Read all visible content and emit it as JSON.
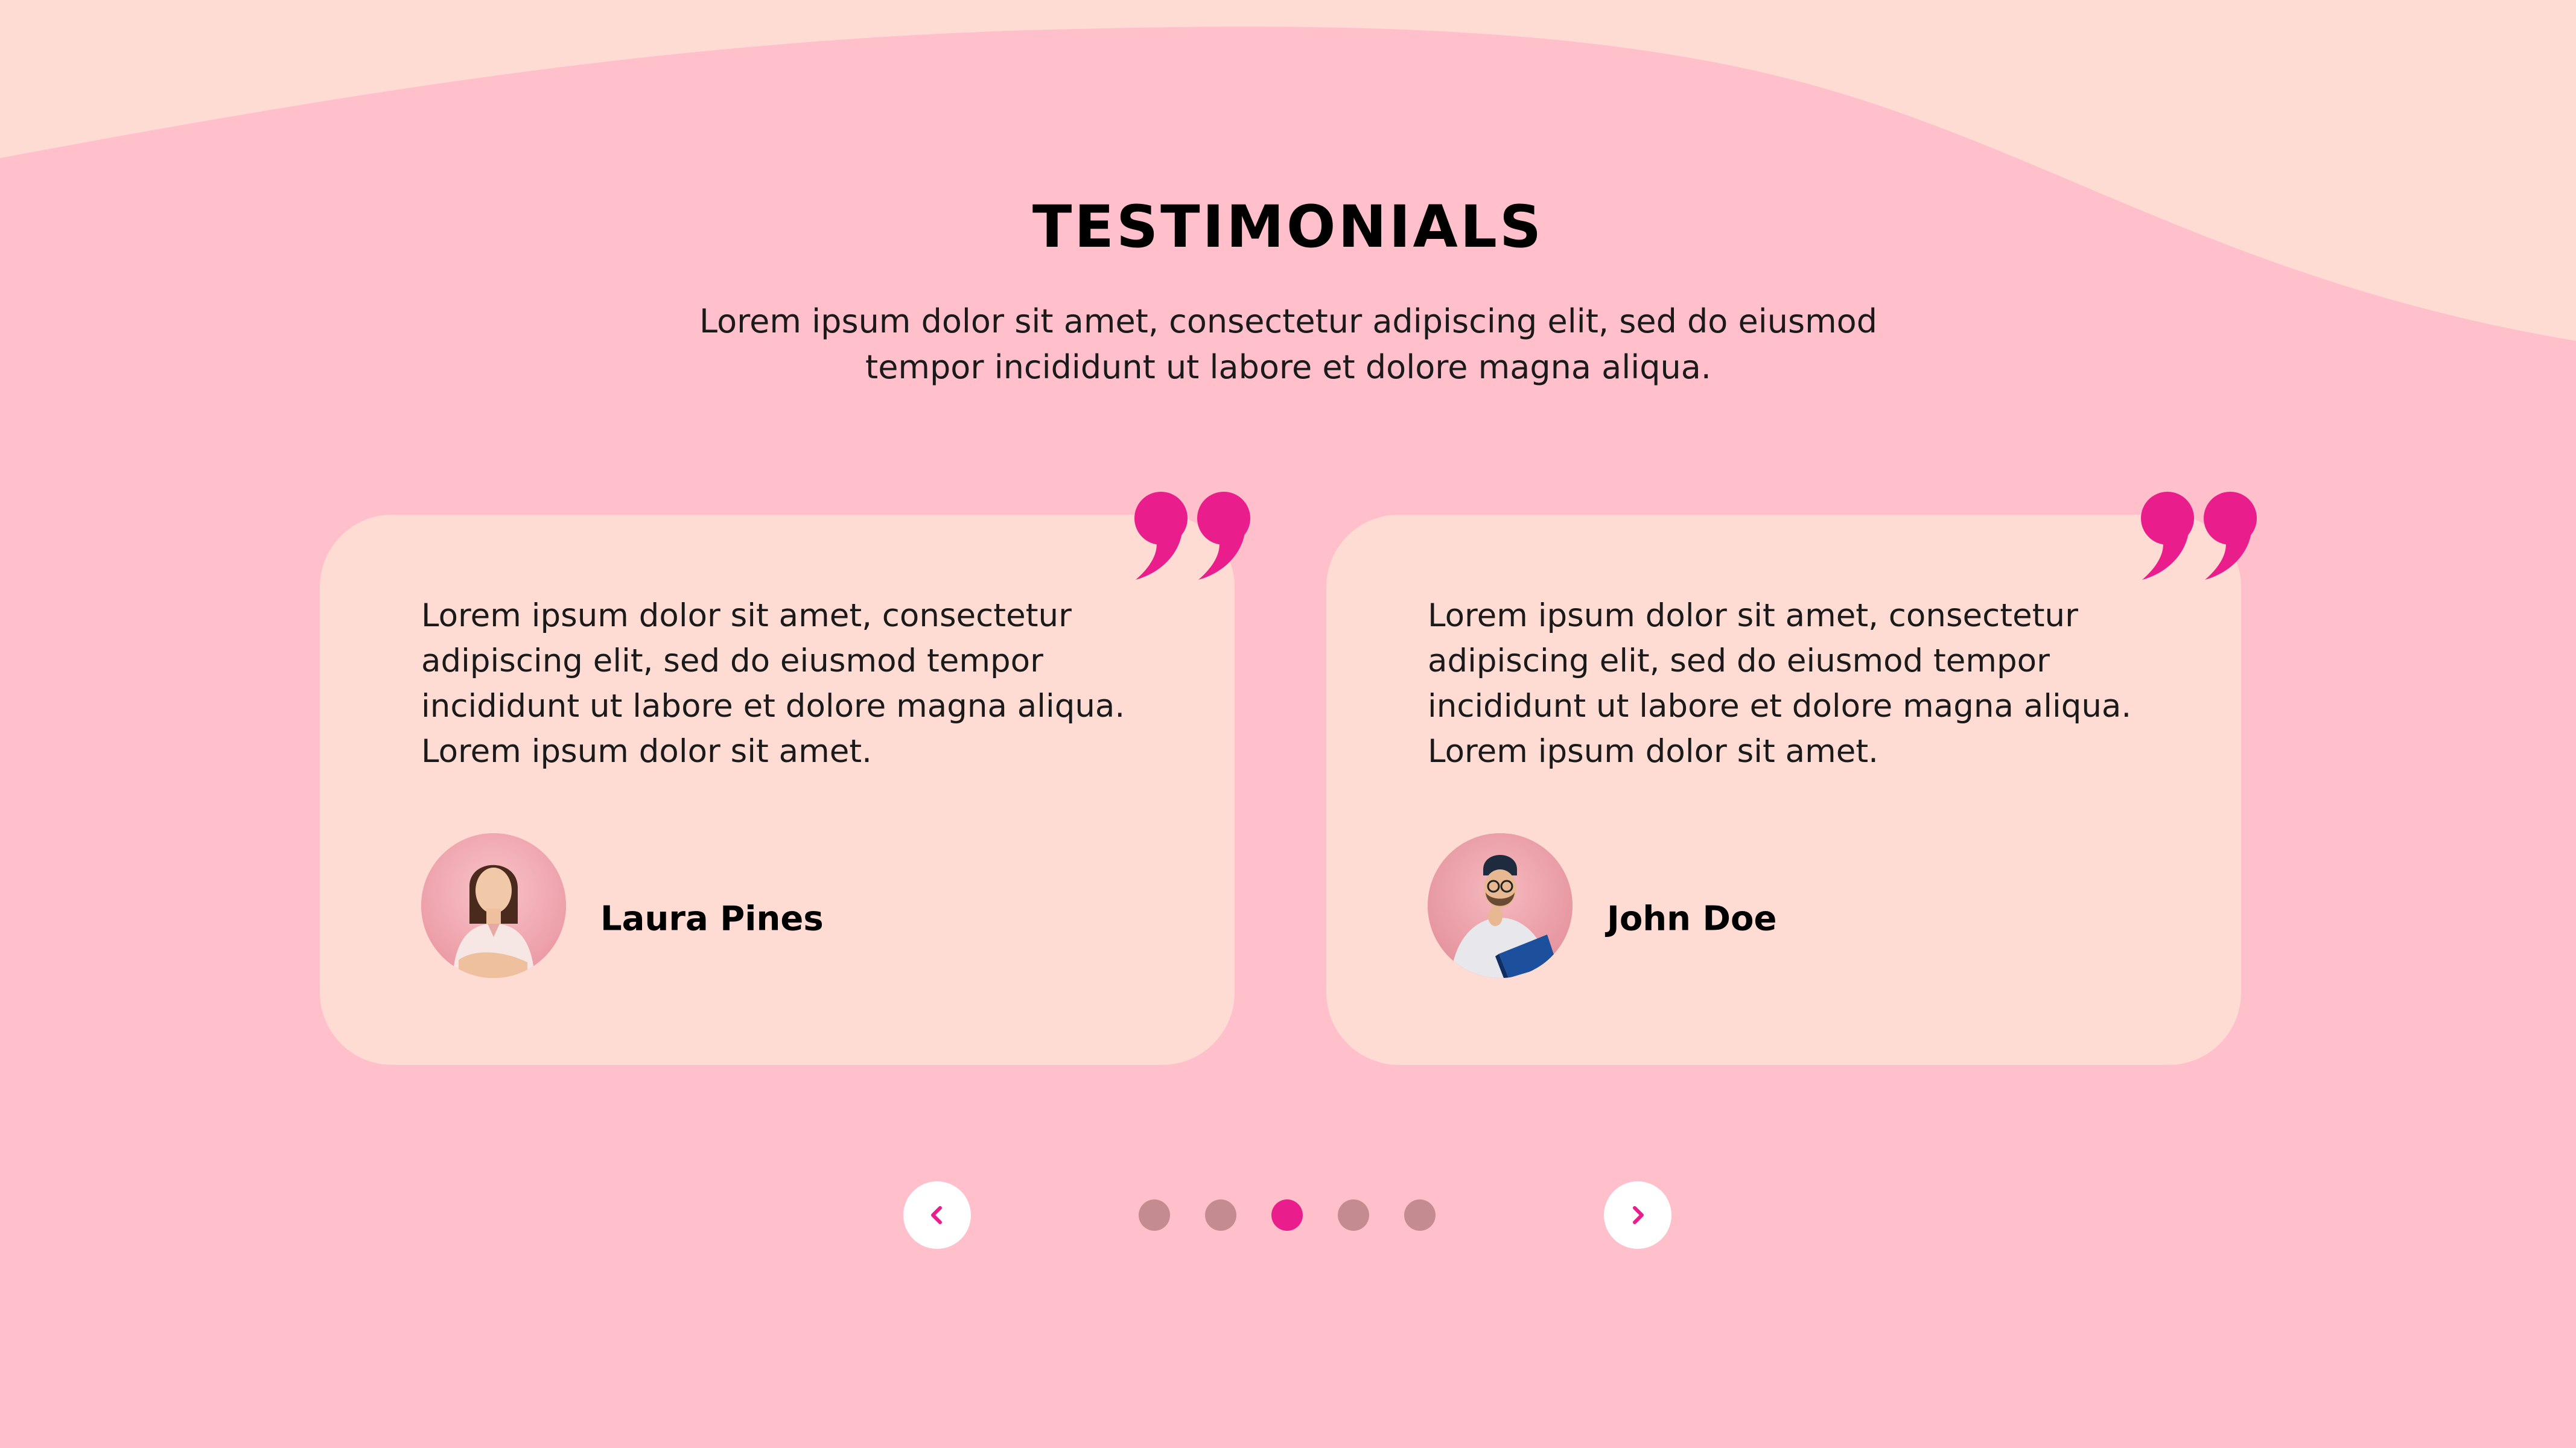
{
  "colors": {
    "background": "#FFBFCB",
    "wave": "#FFDCD3",
    "card": "#FFDCD3",
    "accent": "#E91E8C",
    "dot_inactive": "#C48C90",
    "button_bg": "#FFFFFF"
  },
  "section": {
    "title": "TESTIMONIALS",
    "subtitle": "Lorem ipsum dolor sit amet, consectetur adipiscing elit, sed do eiusmod tempor incididunt ut labore et dolore magna aliqua."
  },
  "testimonials": [
    {
      "quote": "Lorem ipsum dolor sit amet, consectetur adipiscing elit, sed do eiusmod tempor incididunt ut labore et dolore magna aliqua. Lorem ipsum dolor sit amet.",
      "author": "Laura Pines",
      "avatar_icon": "woman-portrait-avatar",
      "quote_icon": "quote-mark-icon"
    },
    {
      "quote": "Lorem ipsum dolor sit amet, consectetur adipiscing elit, sed do eiusmod tempor incididunt ut labore et dolore magna aliqua. Lorem ipsum dolor sit amet.",
      "author": "John Doe",
      "avatar_icon": "man-reading-portrait-avatar",
      "quote_icon": "quote-mark-icon"
    }
  ],
  "carousel": {
    "prev_icon": "chevron-left-icon",
    "next_icon": "chevron-right-icon",
    "total_slides": 5,
    "active_index": 2
  }
}
